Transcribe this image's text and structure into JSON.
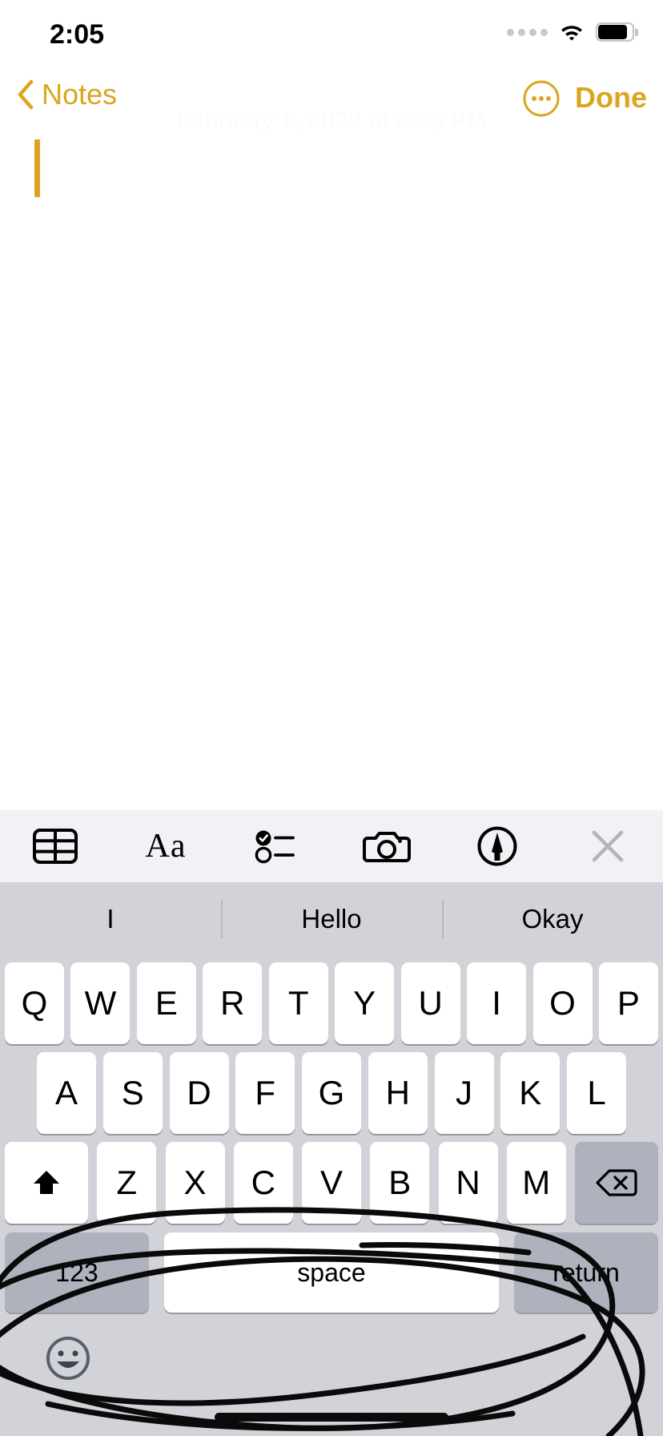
{
  "status_bar": {
    "time": "2:05",
    "cellular_icon": "cellular-dots-icon",
    "wifi_icon": "wifi-icon",
    "battery_icon": "battery-icon"
  },
  "nav_bar": {
    "back_label": "Notes",
    "back_icon": "chevron-left-icon",
    "more_icon": "ellipsis-circle-icon",
    "done_label": "Done"
  },
  "note": {
    "date": "February 1, 2022 at 2:03 PM",
    "body_text": "",
    "cursor_color": "#DCA520"
  },
  "toolbar": {
    "items": [
      {
        "name": "table-icon",
        "label": ""
      },
      {
        "name": "format-icon",
        "label": "Aa"
      },
      {
        "name": "checklist-icon",
        "label": ""
      },
      {
        "name": "camera-icon",
        "label": ""
      },
      {
        "name": "markup-icon",
        "label": ""
      },
      {
        "name": "close-icon",
        "label": ""
      }
    ]
  },
  "keyboard": {
    "predictions": [
      "I",
      "Hello",
      "Okay"
    ],
    "row1": [
      "Q",
      "W",
      "E",
      "R",
      "T",
      "Y",
      "U",
      "I",
      "O",
      "P"
    ],
    "row2": [
      "A",
      "S",
      "D",
      "F",
      "G",
      "H",
      "J",
      "K",
      "L"
    ],
    "row3": [
      "Z",
      "X",
      "C",
      "V",
      "B",
      "N",
      "M"
    ],
    "shift_icon": "shift-icon",
    "delete_icon": "backspace-icon",
    "numbers_label": "123",
    "space_label": "space",
    "return_label": "return",
    "emoji_icon": "emoji-smiley-icon"
  },
  "annotation": {
    "type": "freehand-ink-scribble",
    "color": "#000000",
    "description": "large hand-drawn oval loop over the bottom keyboard area"
  },
  "colors": {
    "accent_gold": "#DCA520",
    "toolbar_bg": "#F1F1F6",
    "keyboard_bg": "#D1D3D9",
    "key_white": "#FFFFFF",
    "key_gray": "#ADB2BD",
    "date_text": "#FBFBFB"
  }
}
